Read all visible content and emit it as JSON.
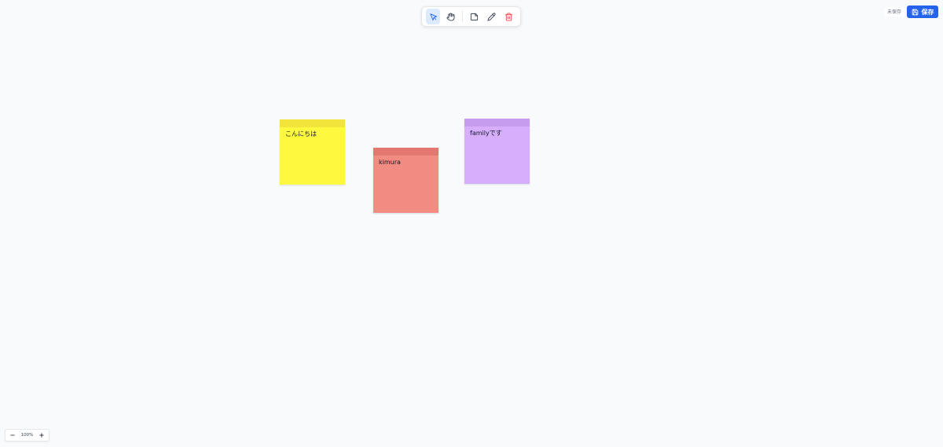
{
  "toolbar": {
    "tools": [
      {
        "name": "select-tool",
        "icon": "cursor-icon",
        "active": true
      },
      {
        "name": "pan-tool",
        "icon": "hand-icon",
        "active": false
      },
      {
        "name": "sticky-note-tool",
        "icon": "sticky-note-icon",
        "active": false
      },
      {
        "name": "pen-tool",
        "icon": "pencil-icon",
        "active": false
      },
      {
        "name": "delete-tool",
        "icon": "trash-icon",
        "active": false
      }
    ],
    "active_color": "#2563eb",
    "delete_color": "#ef4444"
  },
  "header": {
    "status_text": "未保存",
    "save_label": "保存",
    "save_icon": "save-icon",
    "save_color": "#2563eb"
  },
  "notes": [
    {
      "text": "こんにちは",
      "color": "#fef93f",
      "header_color": "#f2e43a"
    },
    {
      "text": "kimura",
      "color": "#f28b82",
      "header_color": "#e37870"
    },
    {
      "text": "familyです",
      "color": "#d7aefb",
      "header_color": "#c69cef"
    }
  ],
  "zoom": {
    "level": "100%",
    "minus_icon": "minus-icon",
    "plus_icon": "plus-icon"
  }
}
